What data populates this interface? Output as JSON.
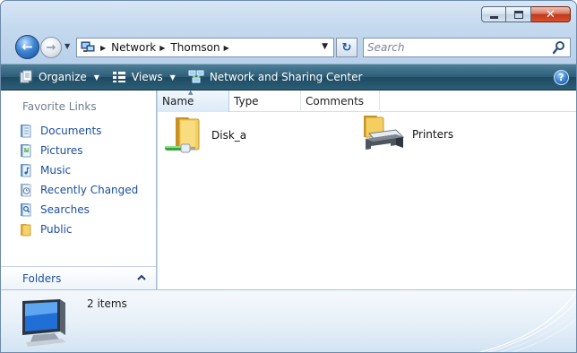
{
  "window": {
    "controls": {
      "minimize": "minimize",
      "maximize": "maximize",
      "close": "✕"
    }
  },
  "address_bar": {
    "crumbs": [
      "Network",
      "Thomson"
    ],
    "search_placeholder": "Search"
  },
  "toolbar": {
    "organize_label": "Organize",
    "views_label": "Views",
    "network_label": "Network and Sharing Center",
    "help_label": "?"
  },
  "nav_pane": {
    "heading": "Favorite Links",
    "links": [
      {
        "label": "Documents",
        "icon": "documents-icon"
      },
      {
        "label": "Pictures",
        "icon": "pictures-icon"
      },
      {
        "label": "Music",
        "icon": "music-icon"
      },
      {
        "label": "Recently Changed",
        "icon": "recently-changed-icon"
      },
      {
        "label": "Searches",
        "icon": "searches-icon"
      },
      {
        "label": "Public",
        "icon": "public-folder-icon"
      }
    ],
    "folders_label": "Folders"
  },
  "content": {
    "columns": [
      "Name",
      "Type",
      "Comments"
    ],
    "items": [
      {
        "label": "Disk_a",
        "icon": "network-share-folder-icon"
      },
      {
        "label": "Printers",
        "icon": "printers-folder-icon"
      }
    ]
  },
  "details": {
    "summary": "2 items",
    "icon": "computer-monitor-icon"
  },
  "colors": {
    "command_bar": "#305f78",
    "link_blue": "#1c4fa0",
    "close_red": "#c1391b"
  }
}
